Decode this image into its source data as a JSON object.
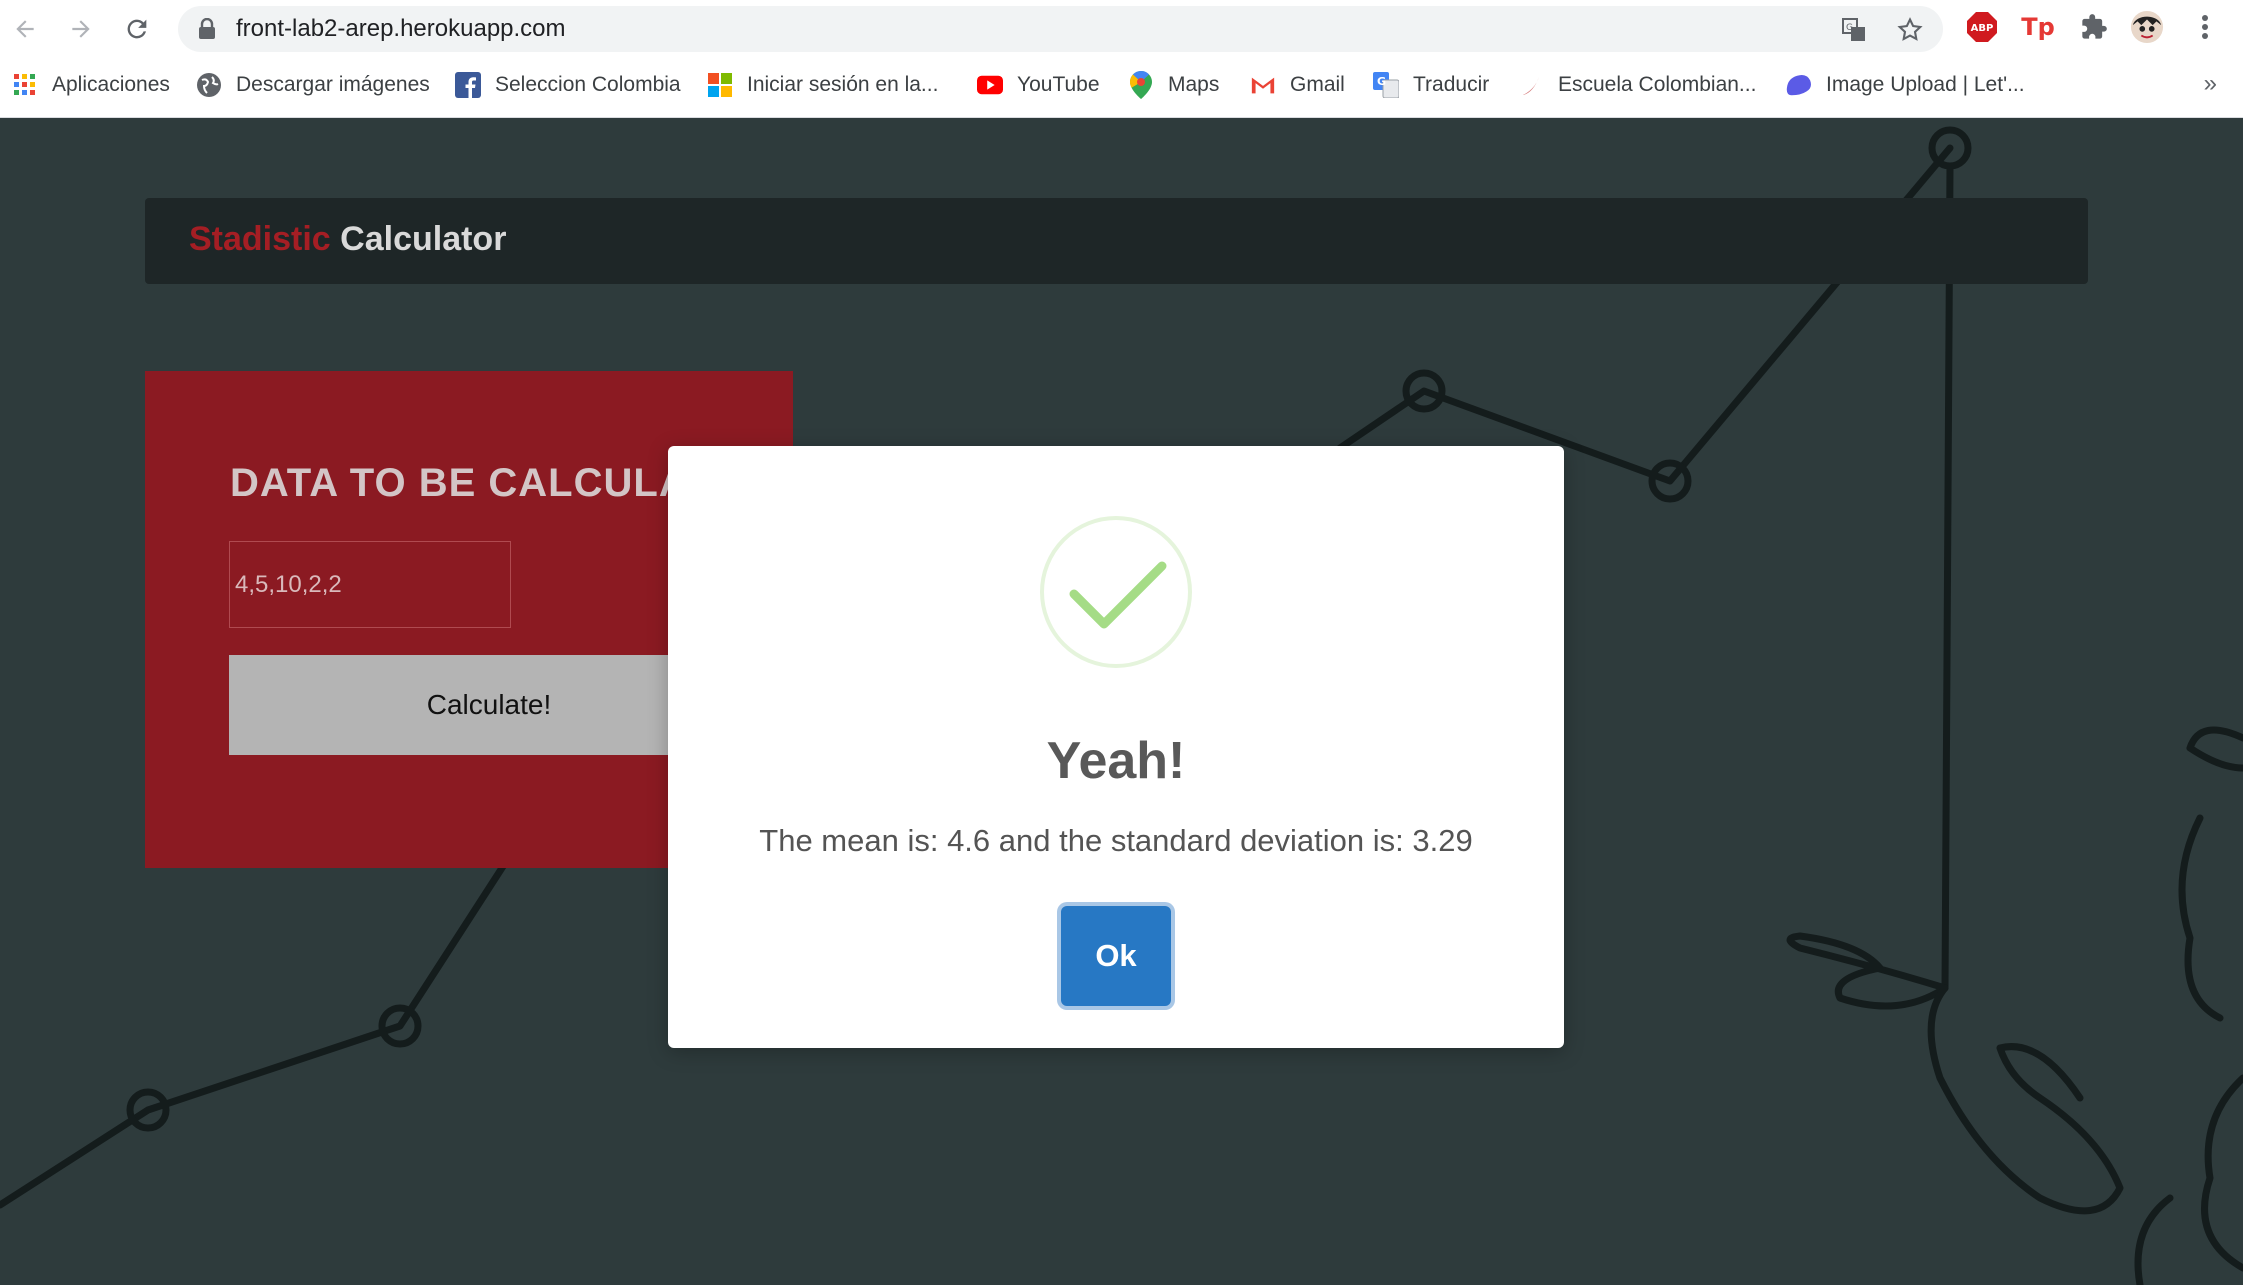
{
  "browser": {
    "url": "front-lab2-arep.herokuapp.com",
    "bookmarks": [
      {
        "label": "Aplicaciones",
        "icon": "apps-grid-icon"
      },
      {
        "label": "Descargar imágenes",
        "icon": "globe-icon"
      },
      {
        "label": "Seleccion Colombia",
        "icon": "facebook-icon"
      },
      {
        "label": "Iniciar sesión en la...",
        "icon": "microsoft-icon"
      },
      {
        "label": "YouTube",
        "icon": "youtube-icon"
      },
      {
        "label": "Maps",
        "icon": "maps-pin-icon"
      },
      {
        "label": "Gmail",
        "icon": "gmail-icon"
      },
      {
        "label": "Traducir",
        "icon": "translate-icon"
      },
      {
        "label": "Escuela Colombian...",
        "icon": "escuela-icon"
      },
      {
        "label": "Image Upload | Let'...",
        "icon": "image-upload-icon"
      }
    ],
    "more_label": "»",
    "extensions": {
      "adblock_label": "ABP",
      "tp_label": "Tp"
    }
  },
  "app": {
    "brand_part1": "Stadistic",
    "brand_part2": "Calculator",
    "card_title": "DATA TO BE CALCULATED",
    "input_value": "4,5,10,2,2",
    "calculate_label": "Calculate!"
  },
  "modal": {
    "title": "Yeah!",
    "message": "The mean is: 4.6 and the standard deviation is: 3.29",
    "ok_label": "Ok"
  },
  "colors": {
    "page_bg": "#2e3b3c",
    "brand_red": "#a51e24",
    "card_red": "#8b1a22",
    "ok_blue": "#2778c4",
    "check_green": "#a5dc86"
  }
}
